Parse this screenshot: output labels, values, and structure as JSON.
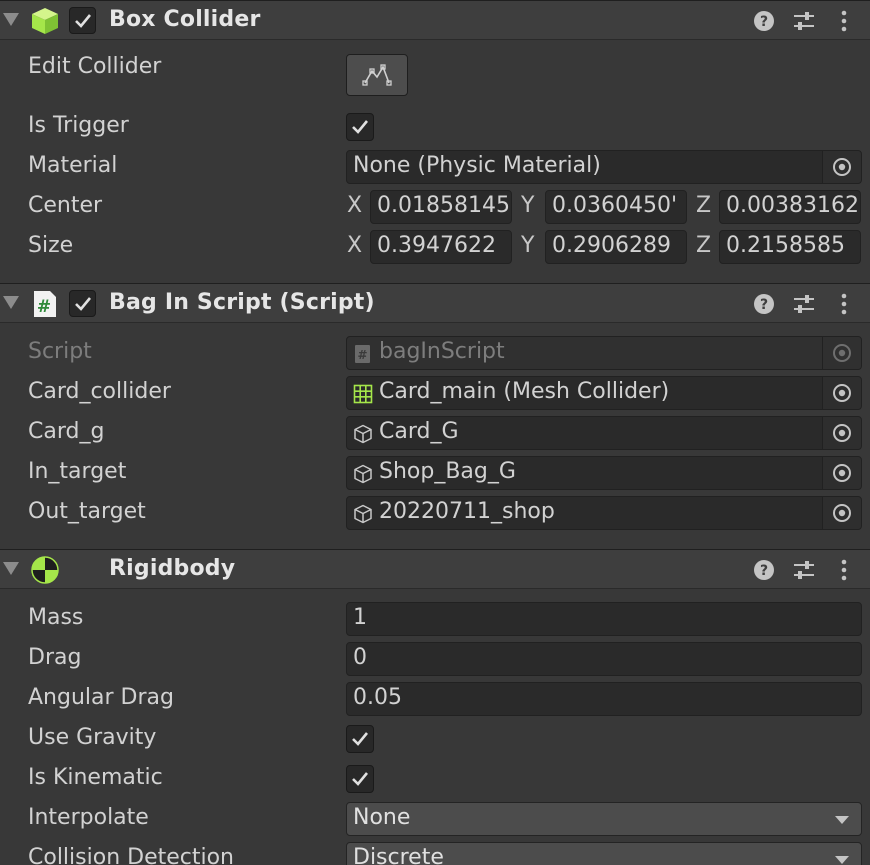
{
  "box_collider": {
    "title": "Box Collider",
    "icon": "cube-icon",
    "enabled": true,
    "edit_collider_label": "Edit Collider",
    "is_trigger_label": "Is Trigger",
    "is_trigger": true,
    "material_label": "Material",
    "material_value": "None (Physic Material)",
    "center_label": "Center",
    "center": {
      "x_label": "X",
      "x": "0.01858145",
      "y_label": "Y",
      "y": "0.0360450'",
      "z_label": "Z",
      "z": "0.00383162"
    },
    "size_label": "Size",
    "size": {
      "x_label": "X",
      "x": "0.3947622",
      "y_label": "Y",
      "y": "0.2906289",
      "z_label": "Z",
      "z": "0.2158585"
    }
  },
  "bag_script": {
    "title": "Bag In Script (Script)",
    "icon": "script-hash-icon",
    "enabled": true,
    "script_label": "Script",
    "script_value": "bagInScript",
    "card_collider_label": "Card_collider",
    "card_collider_value": "Card_main (Mesh Collider)",
    "card_g_label": "Card_g",
    "card_g_value": "Card_G",
    "in_target_label": "In_target",
    "in_target_value": "Shop_Bag_G",
    "out_target_label": "Out_target",
    "out_target_value": "20220711_shop"
  },
  "rigidbody": {
    "title": "Rigidbody",
    "icon": "rigidbody-icon",
    "mass_label": "Mass",
    "mass": "1",
    "drag_label": "Drag",
    "drag": "0",
    "angular_drag_label": "Angular Drag",
    "angular_drag": "0.05",
    "use_gravity_label": "Use Gravity",
    "use_gravity": true,
    "is_kinematic_label": "Is Kinematic",
    "is_kinematic": true,
    "interpolate_label": "Interpolate",
    "interpolate": "None",
    "collision_detection_label": "Collision Detection",
    "collision_detection": "Discrete"
  },
  "colors": {
    "background": "#383838",
    "header": "#3e3e3e",
    "field": "#2a2a2a",
    "accent_green": "#a5e64a"
  }
}
